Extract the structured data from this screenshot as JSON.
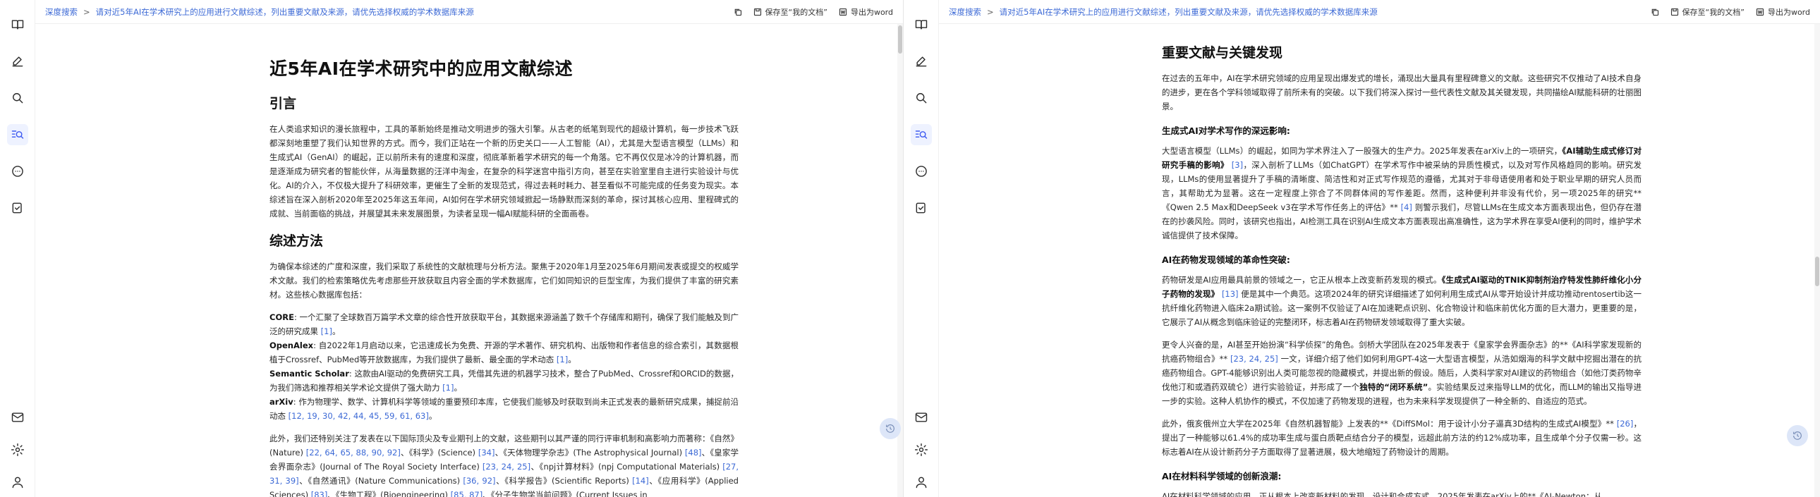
{
  "breadcrumb": {
    "root": "深度搜索",
    "separator": ">",
    "current": "请对近5年AI在学术研究上的应用进行文献综述，列出重要文献及来源，请优先选择权威的学术数据库来源"
  },
  "toolbar": {
    "save_label": "保存至“我的文档”",
    "export_label": "导出为word"
  },
  "sidebar": {
    "items": [
      "book-icon",
      "pen-icon",
      "search-icon",
      "deep-search-icon",
      "chat-icon",
      "task-icon"
    ],
    "bottom": [
      "mail-icon",
      "gear-icon",
      "user-icon"
    ]
  },
  "left_doc": {
    "title": "近5年AI在学术研究中的应用文献综述",
    "intro_heading": "引言",
    "intro": "在人类追求知识的漫长旅程中，工具的革新始终是推动文明进步的强大引擎。从古老的纸笔到现代的超级计算机，每一步技术飞跃都深刻地重塑了我们认知世界的方式。而今，我们正站在一个新的历史关口——人工智能（AI），尤其是大型语言模型（LLMs）和生成式AI（GenAI）的崛起，正以前所未有的速度和深度，彻底革新着学术研究的每一个角落。它不再仅仅是冰冷的计算机器，而是逐渐成为研究者的智能伙伴，从海量数据的汪洋中淘金，在复杂的科学迷宫中指引方向，甚至在实验室里自主进行实验设计与优化。AI的介入，不仅极大提升了科研效率，更催生了全新的发现范式，得过去耗时耗力、甚至看似不可能完成的任务变为现实。本综述旨在深入剖析2020年至2025年这五年间，AI如何在学术研究领域掀起一场静默而深刻的革命，探讨其核心应用、里程碑式的成就、当前面临的挑战，并展望其未来发展图景，为读者呈现一幅AI赋能科研的全面画卷。",
    "method_heading": "综述方法",
    "method": "为确保本综述的广度和深度，我们采取了系统性的文献梳理与分析方法。聚焦于2020年1月至2025年6月期间发表或提交的权威学术文献。我们的检索策略优先考虑那些开放获取且内容全面的学术数据库，它们如同知识的巨型宝库，为我们提供了丰富的研究素材。这些核心数据库包括：",
    "sources": [
      {
        "name": "CORE",
        "text": ": 一个汇聚了全球数百万篇学术文章的综合性开放获取平台，其数据来源涵盖了数千个存储库和期刊，确保了我们能触及到广泛的研究成果 ",
        "cites": "[1]",
        "end": "。"
      },
      {
        "name": "OpenAlex",
        "text": ": 自2022年1月启动以来，它迅速成长为免费、开源的学术著作、研究机构、出版物和作者信息的综合索引，其数据根植于Crossref、PubMed等开放数据库，为我们提供了最新、最全面的学术动态 ",
        "cites": "[1]",
        "end": "。"
      },
      {
        "name": "Semantic Scholar",
        "text": ": 这款由AI驱动的免费研究工具，凭借其先进的机器学习技术，整合了PubMed、Crossref和ORCID的数据，为我们筛选和推荐相关学术论文提供了强大助力 ",
        "cites": "[1]",
        "end": "。"
      },
      {
        "name": "arXiv",
        "text": ": 作为物理学、数学、计算机科学等领域的重要预印本库，它使我们能够及时获取到尚未正式发表的最新研究成果，捕捉前沿动态 ",
        "cites": "[12, 19, 30, 42, 44, 45, 59, 61, 63]",
        "end": "。"
      }
    ],
    "journals_lead": "此外，我们还特别关注了发表在以下国际顶尖及专业期刊上的文献，这些期刊以其严谨的同行评审机制和高影响力而著称：《自然》(Nature) ",
    "journals": [
      {
        "pre": "",
        "cites": "[22, 64, 65, 88, 90, 92]"
      },
      {
        "pre": "、《科学》(Science) ",
        "cites": "[34]"
      },
      {
        "pre": "、《天体物理学杂志》(The Astrophysical Journal) ",
        "cites": "[48]"
      },
      {
        "pre": "、《皇家学会界面杂志》(Journal of The Royal Society Interface) ",
        "cites": "[23, 24, 25]"
      },
      {
        "pre": "、《npj计算材料》(npj Computational Materials) ",
        "cites": "[27, 31, 39]"
      },
      {
        "pre": "、《自然通讯》(Nature Communications) ",
        "cites": "[36, 92]"
      },
      {
        "pre": "、《科学报告》(Scientific Reports) ",
        "cites": "[14]"
      },
      {
        "pre": "、《应用科学》(Applied Sciences) ",
        "cites": "[83]"
      },
      {
        "pre": "、《生物工程》(Bioengineering) ",
        "cites": "[85, 87]"
      }
    ],
    "journals_tail": "、《分子生物学当前问题》(Current Issues in"
  },
  "right_doc": {
    "heading": "重要文献与关键发现",
    "lead": "在过去的五年中，AI在学术研究领域的应用呈现出爆发式的增长，涌现出大量具有里程碑意义的文献。这些研究不仅推动了AI技术自身的进步，更在各个学科领域取得了前所未有的突破。以下我们将深入探讨一些代表性文献及其关键发现，共同描绘AI赋能科研的壮丽图景。",
    "s1_heading": "生成式AI对学术写作的深远影响:",
    "s1_a": "大型语言模型（LLMs）的崛起，如同为学术界注入了一股强大的生产力。2025年发表在arXiv上的一项研究，",
    "s1_bold": "《AI辅助生成式修订对研究手稿的影响》",
    "s1_c1": "[3]",
    "s1_b": "，深入剖析了LLMs（如ChatGPT）在学术写作中被采纳的异质性模式，以及对写作风格趋同的影响。研究发现，LLMs的使用显著提升了手稿的清晰度、简洁性和对正式写作规范的遵循，尤其对于非母语使用者和处于职业早期的研究人员而言，其帮助尤为显著。这在一定程度上弥合了不同群体间的写作差距。然而，这种便利并非没有代价，另一项2025年的研究**《Qwen 2.5 Max和DeepSeek v3在学术写作任务上的评估》** ",
    "s1_c2": "[4]",
    "s1_c": " 则警示我们，尽管LLMs在生成文本方面表现出色，但仍存在潜在的抄袭风险。同时，该研究也指出，AI检测工具在识别AI生成文本方面表现出高准确性，这为学术界在享受AI便利的同时，维护学术诚信提供了技术保障。",
    "s2_heading": "AI在药物发现领域的革命性突破:",
    "s2_a": "药物研发是AI应用最具前景的领域之一，它正从根本上改变新药发现的模式。",
    "s2_bold": "《生成式AI驱动的TNIK抑制剂治疗特发性肺纤维化小分子药物的发现》",
    "s2_c1": "[13]",
    "s2_b": " 便是其中一个典范。这项2024年的研究详细描述了如何利用生成式AI从零开始设计并成功推动rentosertib这一抗纤维化药物进入临床2a期试验。这一案例不仅验证了AI在加速靶点识别、化合物设计和临床前优化方面的巨大潜力，更重要的是，它展示了AI从概念到临床验证的完整闭环，标志着AI在药物研发领域取得了重大实破。",
    "s2_d": "更令人兴奋的是，AI甚至开始扮演“科学侦探”的角色。剑桥大学团队在2025年发表于《皇家学会界面杂志》的**《AI科学家发现新的抗癌药物组合》** ",
    "s2_c2": "[23, 24, 25]",
    "s2_e": " 一文，详细介绍了他们如何利用GPT-4这一大型语言模型，从浩如烟海的科学文献中挖掘出潜在的抗癌药物组合。GPT-4能够识别出人类可能忽视的隐藏模式，并提出新的假设。随后，人类科学家对AI建议的药物组合（如他汀类药物辛伐他汀和或酒药双硫仑）进行实验验证，并形成了一个",
    "s2_bold2": "独特的“闭环系统”",
    "s2_f": "。实验结果反过来指导LLM的优化，而LLM的输出又指导进一步的实验。这种人机协作的模式，不仅加速了药物发现的进程，也为未来科学发现提供了一种全新的、自适应的范式。",
    "s2_g": "此外，俄亥俄州立大学在2025年《自然机器智能》上发表的**《DiffSMol：用于设计小分子逼真3D结构的生成式AI模型》** ",
    "s2_c3": "[26]",
    "s2_h": "，提出了一种能够以61.4%的成功率生成与蛋白质靶点结合分子的模型，远超此前方法的约12%成功率，且生成单个分子仅需一秒。这标志着AI在从设计新药分子方面取得了显著进展，极大地缩短了药物设计的周期。",
    "s3_heading": "AI在材料科学领域的创新浪潮:",
    "s3_a": "AI在材料科学领域的应用，正从根本上改变新材料的发现、设计和合成方式。2025年发表在arXiv上的**《AI-Newton：从"
  }
}
